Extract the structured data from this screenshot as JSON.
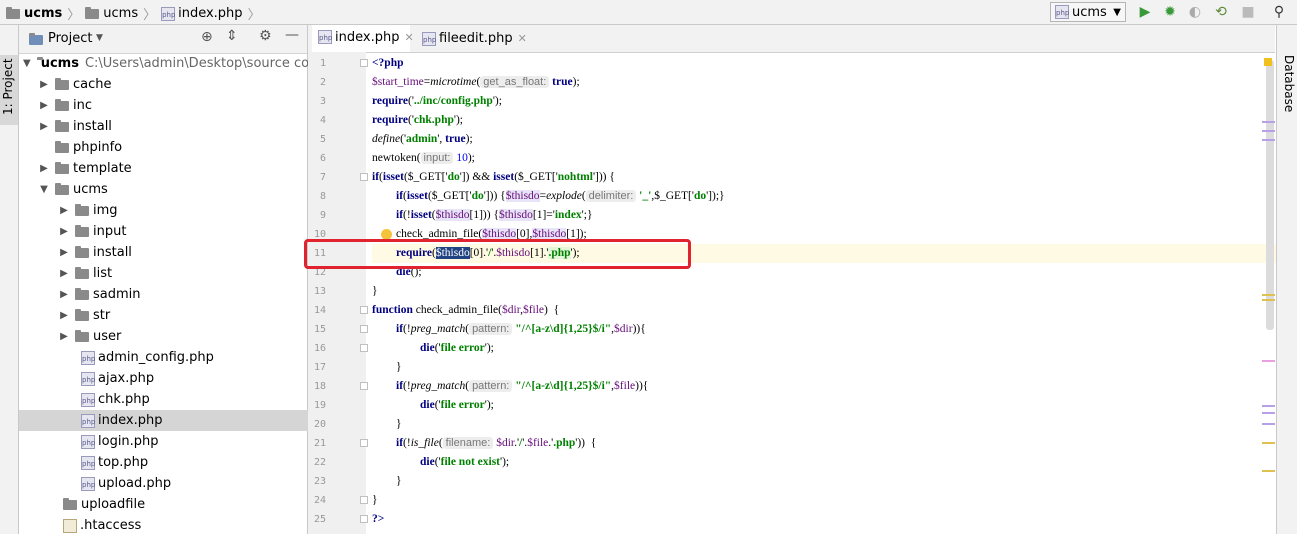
{
  "breadcrumb": {
    "project": "ucms",
    "folder": "ucms",
    "file": "index.php"
  },
  "toolbar": {
    "run_config": "ucms"
  },
  "sidebar": {
    "strip_label": "1: Project",
    "panel_title": "Project",
    "root": {
      "name": "ucms",
      "path": "C:\\Users\\admin\\Desktop\\source cod"
    },
    "items": [
      {
        "label": "cache"
      },
      {
        "label": "inc"
      },
      {
        "label": "install"
      },
      {
        "label": "phpinfo"
      },
      {
        "label": "template"
      },
      {
        "label": "ucms"
      },
      {
        "label": "img"
      },
      {
        "label": "input"
      },
      {
        "label": "install"
      },
      {
        "label": "list"
      },
      {
        "label": "sadmin"
      },
      {
        "label": "str"
      },
      {
        "label": "user"
      },
      {
        "label": "admin_config.php"
      },
      {
        "label": "ajax.php"
      },
      {
        "label": "chk.php"
      },
      {
        "label": "index.php"
      },
      {
        "label": "login.php"
      },
      {
        "label": "top.php"
      },
      {
        "label": "upload.php"
      },
      {
        "label": "uploadfile"
      },
      {
        "label": ".htaccess"
      }
    ]
  },
  "editor": {
    "tabs": [
      {
        "label": "index.php"
      },
      {
        "label": "fileedit.php"
      }
    ],
    "line_numbers": [
      "1",
      "2",
      "3",
      "4",
      "5",
      "6",
      "7",
      "8",
      "9",
      "10",
      "11",
      "12",
      "13",
      "14",
      "15",
      "16",
      "17",
      "18",
      "19",
      "20",
      "21",
      "22",
      "23",
      "24",
      "25"
    ],
    "code": {
      "l1": "<?php",
      "l2_a": "$start_time",
      "l2_b": "=",
      "l2_c": "microtime",
      "l2_d": "(",
      "l2_hint": "get_as_float:",
      "l2_e": "true",
      "l2_f": ");",
      "l3_a": "require",
      "l3_b": "('",
      "l3_c": "../inc/config.php",
      "l3_d": "');",
      "l4_a": "require",
      "l4_b": "('",
      "l4_c": "chk.php",
      "l4_d": "');",
      "l5_a": "define",
      "l5_b": "('",
      "l5_c": "admin",
      "l5_d": "', ",
      "l5_e": "true",
      "l5_f": ");",
      "l6_a": "newtoken(",
      "l6_hint": "input:",
      "l6_b": "10",
      "l6_c": ");",
      "l7_a": "if",
      "l7_b": "(",
      "l7_c": "isset",
      "l7_d": "($_GET['",
      "l7_e": "do",
      "l7_f": "']) && ",
      "l7_g": "isset",
      "l7_h": "($_GET['",
      "l7_i": "nohtml",
      "l7_j": "'])) {",
      "l8_a": "if",
      "l8_b": "(",
      "l8_c": "isset",
      "l8_d": "($_GET['",
      "l8_e": "do",
      "l8_f": "'])) {",
      "l8_g": "$thisdo",
      "l8_h": "=",
      "l8_i": "explode",
      "l8_j": "(",
      "l8_hint": "delimiter:",
      "l8_k": "'_'",
      "l8_l": ",$_GET['",
      "l8_m": "do",
      "l8_n": "']);}",
      "l9_a": "if",
      "l9_b": "(!",
      "l9_c": "isset",
      "l9_d": "(",
      "l9_e": "$thisdo",
      "l9_f": "[1])) {",
      "l9_g": "$thisdo",
      "l9_h": "[1]='",
      "l9_i": "index",
      "l9_j": "';}",
      "l10_a": "check_admin_file(",
      "l10_b": "$thisdo",
      "l10_c": "[0],",
      "l10_d": "$thisdo",
      "l10_e": "[1]);",
      "l11_a": "require",
      "l11_b": "(",
      "l11_c": "$thisdo",
      "l11_d": "[0].'",
      "l11_e": "/",
      "l11_f": "'.",
      "l11_g": "$thisdo",
      "l11_h": "[1].'",
      "l11_i": ".php",
      "l11_j": "');",
      "l12_a": "die",
      "l12_b": "();",
      "l13": "}",
      "l14_a": "function",
      "l14_b": " check_admin_file(",
      "l14_c": "$dir",
      "l14_d": ",",
      "l14_e": "$file",
      "l14_f": ")  {",
      "l15_a": "if",
      "l15_b": "(!",
      "l15_c": "preg_match",
      "l15_d": "(",
      "l15_hint": "pattern:",
      "l15_e": "\"/^[a-z\\d]{1,25}$/i\"",
      "l15_f": ",",
      "l15_g": "$dir",
      "l15_h": ")){",
      "l16_a": "die",
      "l16_b": "('",
      "l16_c": "file error",
      "l16_d": "');",
      "l17": "}",
      "l18_a": "if",
      "l18_b": "(!",
      "l18_c": "preg_match",
      "l18_d": "(",
      "l18_hint": "pattern:",
      "l18_e": "\"/^[a-z\\d]{1,25}$/i\"",
      "l18_f": ",",
      "l18_g": "$file",
      "l18_h": ")){",
      "l19_a": "die",
      "l19_b": "('",
      "l19_c": "file error",
      "l19_d": "');",
      "l20": "}",
      "l21_a": "if",
      "l21_b": "(!",
      "l21_c": "is_file",
      "l21_d": "(",
      "l21_hint": "filename:",
      "l21_e": "$dir",
      "l21_f": ".'",
      "l21_g": "/",
      "l21_h": "'.",
      "l21_i": "$file",
      "l21_j": ".'",
      "l21_k": ".php",
      "l21_l": "'))  {",
      "l22_a": "die",
      "l22_b": "('",
      "l22_c": "file not exist",
      "l22_d": "');",
      "l23": "}",
      "l24": "}",
      "l25": "?>"
    }
  },
  "right_strip": {
    "label": "Database"
  },
  "colors": {
    "keyword": "#000080",
    "string": "#008000",
    "variable": "#660e7a",
    "number": "#0000ff",
    "highlight_box": "#e0232e",
    "selection": "#214283"
  }
}
